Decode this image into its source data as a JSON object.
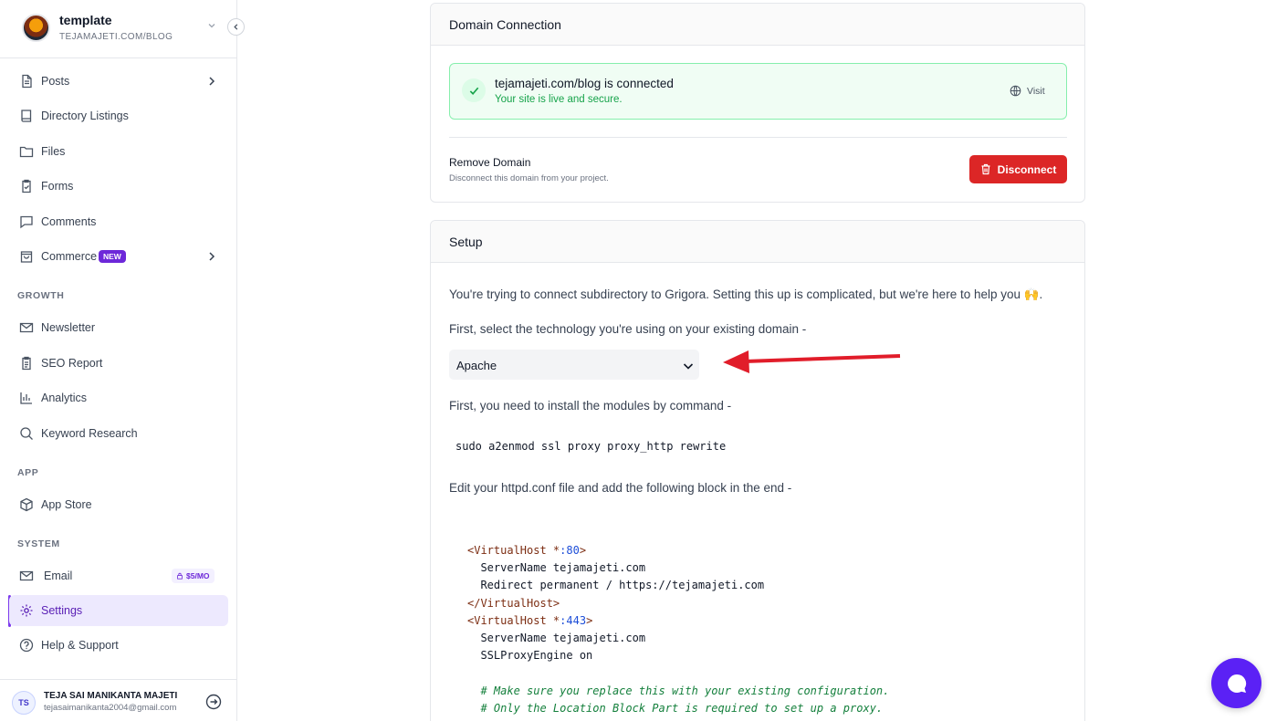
{
  "project": {
    "name": "template",
    "url": "TEJAMAJETI.COM/BLOG"
  },
  "sidebar": {
    "items": [
      {
        "label": "Posts",
        "icon": "file-text-icon"
      },
      {
        "label": "Directory Listings",
        "icon": "book-icon"
      },
      {
        "label": "Files",
        "icon": "folder-icon"
      },
      {
        "label": "Forms",
        "icon": "clipboard-icon"
      },
      {
        "label": "Comments",
        "icon": "message-square-icon"
      },
      {
        "label": "Commerce",
        "icon": "shopping-bag-icon",
        "badge": "NEW"
      }
    ],
    "growth_label": "GROWTH",
    "growth": [
      {
        "label": "Newsletter",
        "icon": "mail-icon"
      },
      {
        "label": "SEO Report",
        "icon": "clipboard-list-icon"
      },
      {
        "label": "Analytics",
        "icon": "bar-chart-icon"
      },
      {
        "label": "Keyword Research",
        "icon": "search-icon"
      }
    ],
    "app_label": "APP",
    "app": [
      {
        "label": "App Store",
        "icon": "package-icon"
      }
    ],
    "system_label": "SYSTEM",
    "system": [
      {
        "label": "Email",
        "icon": "mail-icon",
        "badge": "$5/MO"
      },
      {
        "label": "Settings",
        "icon": "gear-icon",
        "active": true
      },
      {
        "label": "Help & Support",
        "icon": "help-circle-icon"
      }
    ]
  },
  "user": {
    "initials": "TS",
    "name": "TEJA SAI MANIKANTA MAJETI",
    "email": "tejasaimanikanta2004@gmail.com"
  },
  "domain": {
    "title": "Domain Connection",
    "connected_title": "tejamajeti.com/blog is connected",
    "connected_sub": "Your site is live and secure.",
    "visit_label": "Visit",
    "remove_title": "Remove Domain",
    "remove_sub": "Disconnect this domain from your project.",
    "disconnect_label": "Disconnect"
  },
  "setup": {
    "title": "Setup",
    "intro": "You're trying to connect subdirectory to Grigora. Setting this up is complicated, but we're here to help you 🙌.",
    "select_prompt": "First, select the technology you're using on your existing domain -",
    "technology": "Apache",
    "install_prompt": "First, you need to install the modules by command -",
    "command": "sudo a2enmod ssl proxy proxy_http rewrite",
    "edit_prompt": "Edit your httpd.conf file and add the following block in the end -",
    "code": {
      "l1_tag": "<VirtualHost *",
      "l1_port": ":80",
      "l1_end": ">",
      "l2": "  ServerName tejamajeti.com",
      "l3": "  Redirect permanent / https://tejamajeti.com",
      "l4": "</VirtualHost>",
      "l5_tag": "<VirtualHost *",
      "l5_port": ":443",
      "l5_end": ">",
      "l6": "  ServerName tejamajeti.com",
      "l7": "  SSLProxyEngine on",
      "l8": "  # Make sure you replace this with your existing configuration.",
      "l9": "  # Only the Location Block Part is required to set up a proxy."
    }
  },
  "colors": {
    "accent": "#7c3aed",
    "danger": "#dc2626",
    "success": "#16a34a",
    "chat": "#5b21f5"
  }
}
